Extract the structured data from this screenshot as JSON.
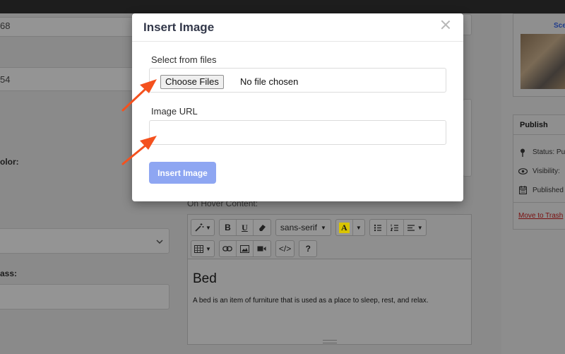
{
  "background": {
    "field1_value": "68",
    "field2_value": "54",
    "color_label": "olor:",
    "class_label": "ass:",
    "editor_label": "On Hover Content:",
    "toolbar": {
      "font_name": "sans-serif",
      "highlight_letter": "A",
      "bold": "B",
      "underline": "U",
      "code": "</>",
      "help": "?"
    },
    "content": {
      "heading": "Bed",
      "paragraph": "A bed is an item of furniture that is used as a place to sleep, rest, and relax."
    },
    "sidebar": {
      "featured_link": "Sce",
      "publish_title": "Publish",
      "status_label": "Status: Pu",
      "visibility_label": "Visibility:",
      "published_label": "Published",
      "trash_link": "Move to Trash"
    }
  },
  "modal": {
    "title": "Insert Image",
    "file_label": "Select from files",
    "choose_button": "Choose Files",
    "no_file_text": "No file chosen",
    "url_label": "Image URL",
    "url_value": "",
    "insert_button": "Insert Image"
  },
  "colors": {
    "arrow": "#f4511e",
    "insert_button": "#8ea6f2",
    "title": "#33384a"
  },
  "icons": [
    "magic-wand-icon",
    "eraser-icon",
    "bullet-list-icon",
    "numbered-list-icon",
    "align-icon",
    "table-icon",
    "link-icon",
    "image-icon",
    "video-icon",
    "pin-icon",
    "eye-icon",
    "calendar-icon",
    "close-icon"
  ]
}
